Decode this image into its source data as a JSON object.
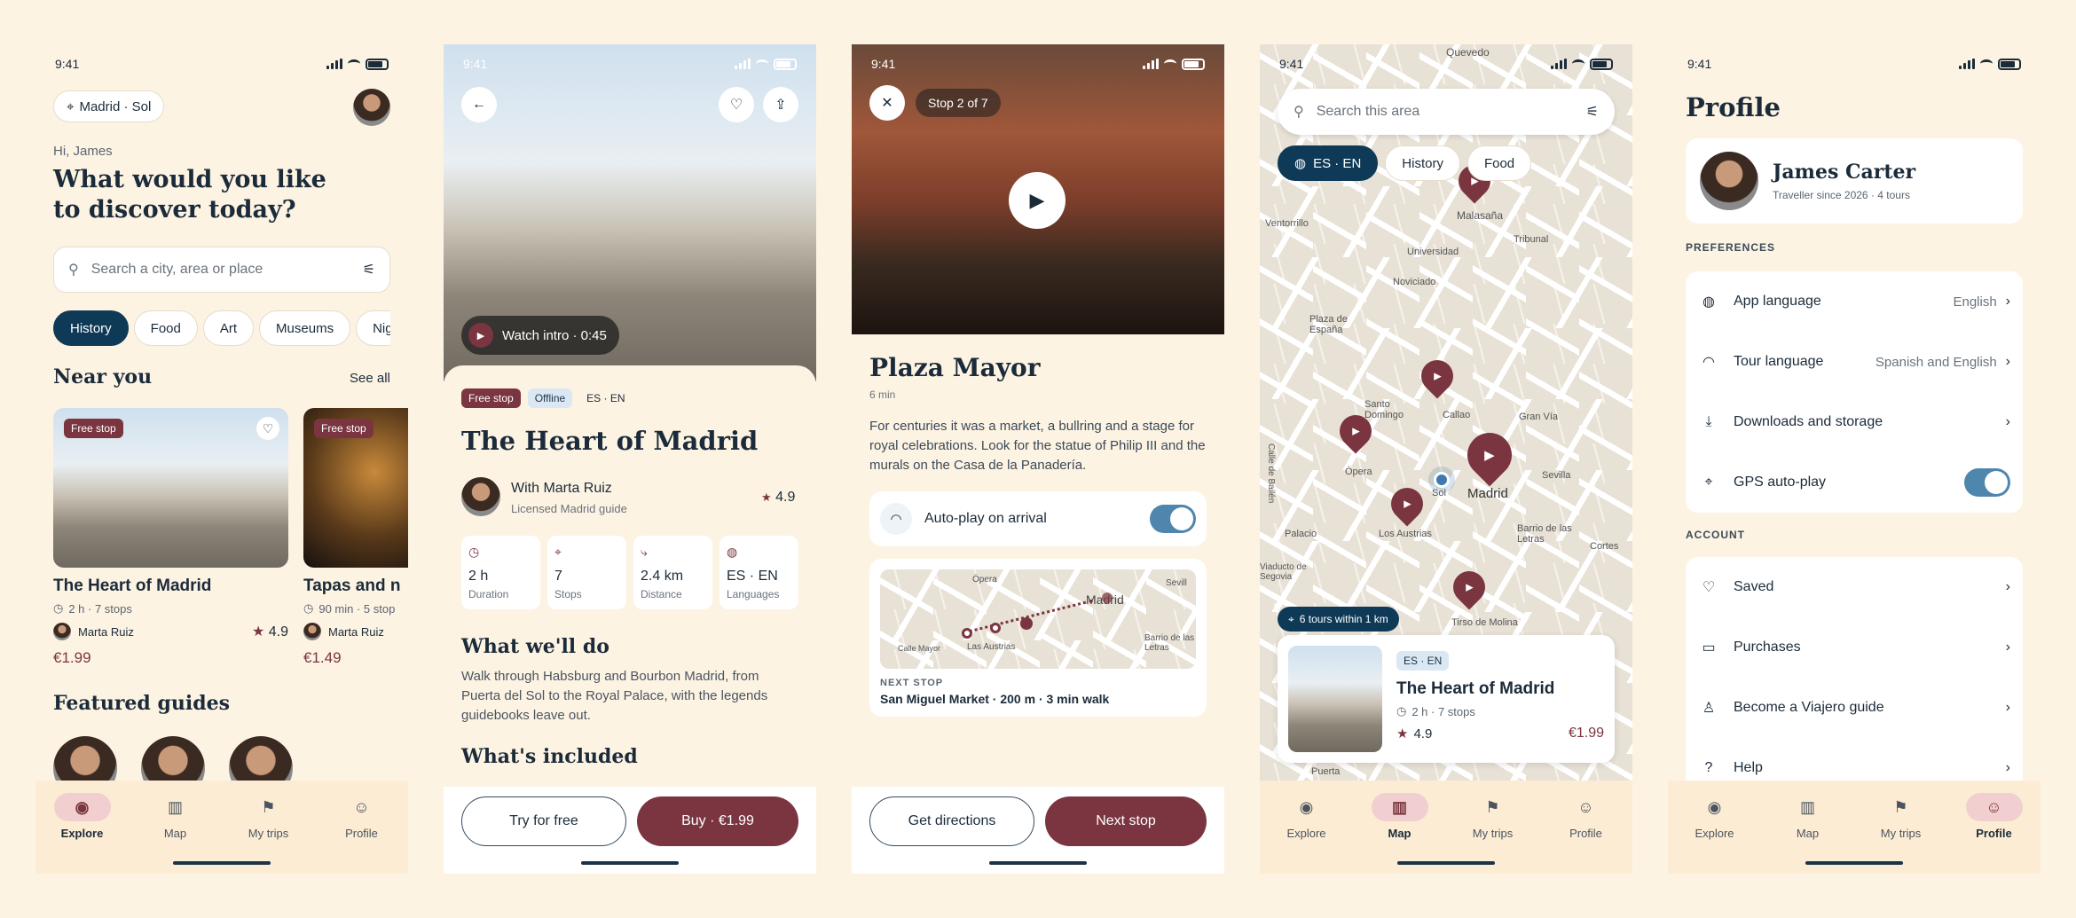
{
  "status_time": "9:41",
  "tabs": [
    "Explore",
    "Map",
    "My trips",
    "Profile"
  ],
  "s1": {
    "location": "Madrid · Sol",
    "greeting": "Hi, James",
    "headline": "What would you like to discover today?",
    "search_placeholder": "Search a city, area or place",
    "chips": [
      "History",
      "Food",
      "Art",
      "Museums",
      "Nig"
    ],
    "near_title": "Near you",
    "see_all": "See all",
    "cards": [
      {
        "badge": "Free stop",
        "title": "The Heart of Madrid",
        "meta": "2 h · 7 stops",
        "guide": "Marta Ruiz",
        "rating": "4.9",
        "price": "€1.99"
      },
      {
        "badge": "Free stop",
        "title": "Tapas and n",
        "meta": "90 min · 5 stop",
        "guide": "Marta Ruiz",
        "price": "€1.49"
      }
    ],
    "featured_title": "Featured guides"
  },
  "s2": {
    "watch": "Watch intro · 0:45",
    "badges": [
      "Free stop",
      "Offline",
      "ES · EN"
    ],
    "title": "The Heart of Madrid",
    "guide": "With Marta Ruiz",
    "guide_sub": "Licensed Madrid guide",
    "rating": "4.9",
    "stats": [
      {
        "v": "2 h",
        "l": "Duration",
        "icon": "clock-icon"
      },
      {
        "v": "7",
        "l": "Stops",
        "icon": "pin-icon"
      },
      {
        "v": "2.4 km",
        "l": "Distance",
        "icon": "route-icon"
      },
      {
        "v": "ES · EN",
        "l": "Languages",
        "icon": "globe-icon"
      }
    ],
    "do_title": "What we'll do",
    "do_text": "Walk through Habsburg and Bourbon Madrid, from Puerta del Sol to the Royal Palace, with the legends guidebooks leave out.",
    "incl_title": "What's included",
    "try": "Try for free",
    "buy": "Buy · €1.99"
  },
  "s3": {
    "stop": "Stop 2 of 7",
    "title": "Plaza Mayor",
    "duration": "6 min",
    "text": "For centuries it was a market, a bullring and a stage for royal celebrations. Look for the statue of Philip III and the murals on the Casa de la Panadería.",
    "autoplay": "Auto-play on arrival",
    "next_label": "NEXT STOP",
    "next_text": "San Miguel Market · 200 m · 3 min walk",
    "map_labels": [
      "Ópera",
      "Madrid",
      "Las Austrias",
      "Sevill",
      "Barrio de las Letras",
      "Calle Mayor"
    ],
    "directions": "Get directions",
    "next": "Next stop"
  },
  "s4": {
    "search_placeholder": "Search this area",
    "chips": [
      "ES · EN",
      "History",
      "Food"
    ],
    "tours_near": "6 tours within 1 km",
    "map_labels": [
      "Quevedo",
      "Malasaña",
      "Universidad",
      "Tribunal",
      "Noviciado",
      "Plaza de España",
      "Santo Domingo",
      "Callao",
      "Gran Vía",
      "Ópera",
      "Sol",
      "Madrid",
      "Sevilla",
      "Barrio de las Letras",
      "Palacio",
      "Los Austrias",
      "Tirso de Molina",
      "Cortes",
      "Puerta",
      "Ventorrillo",
      "Calle de Bailén",
      "Viaducto de Segovia"
    ],
    "card_badge": "ES · EN",
    "card_title": "The Heart of Madrid",
    "card_meta": "2 h · 7 stops",
    "card_rating": "4.9",
    "card_price": "€1.99"
  },
  "s5": {
    "title": "Profile",
    "name": "James Carter",
    "sub": "Traveller since 2026 · 4 tours",
    "pref_label": "PREFERENCES",
    "prefs": [
      {
        "label": "App language",
        "value": "English",
        "icon": "globe-icon"
      },
      {
        "label": "Tour language",
        "value": "Spanish and English",
        "icon": "headphones-icon"
      },
      {
        "label": "Downloads and storage",
        "value": "",
        "icon": "download-icon"
      }
    ],
    "gps": "GPS auto-play",
    "acct_label": "ACCOUNT",
    "account": [
      "Saved",
      "Purchases",
      "Become a Viajero guide",
      "Help"
    ]
  }
}
